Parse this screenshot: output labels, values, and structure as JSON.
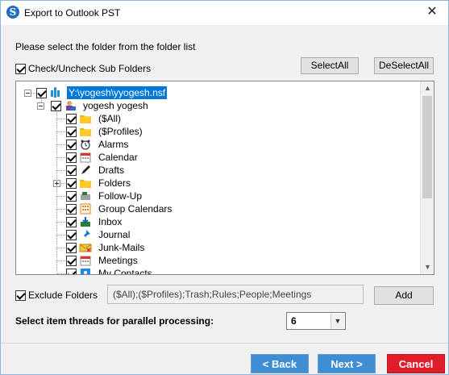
{
  "window": {
    "title": "Export to Outlook PST",
    "app_icon_letter": "S",
    "close_glyph": "✕"
  },
  "instruction": "Please select the folder from the folder list",
  "subfolders_label": "Check/Uncheck Sub Folders",
  "buttons": {
    "select_all": "SelectAll",
    "deselect_all": "DeSelectAll",
    "add": "Add",
    "back": "< Back",
    "next": "Next >",
    "cancel": "Cancel"
  },
  "tree": {
    "root": {
      "label": "Y:\\yogesh\\yyogesh.nsf",
      "icon": "database-icon",
      "checked": true,
      "selected": true
    },
    "user": {
      "label": "yogesh yogesh",
      "icon": "user-mailbox-icon",
      "checked": true
    },
    "items": [
      {
        "label": "($All)",
        "icon": "folder-icon",
        "checked": true
      },
      {
        "label": "($Profiles)",
        "icon": "folder-icon",
        "checked": true
      },
      {
        "label": "Alarms",
        "icon": "alarm-clock-icon",
        "checked": true
      },
      {
        "label": "Calendar",
        "icon": "calendar-icon",
        "checked": true
      },
      {
        "label": "Drafts",
        "icon": "pen-icon",
        "checked": true
      },
      {
        "label": "Folders",
        "icon": "folder-icon",
        "checked": true,
        "expandable": true
      },
      {
        "label": "Follow-Up",
        "icon": "follow-up-icon",
        "checked": true
      },
      {
        "label": "Group Calendars",
        "icon": "group-calendar-icon",
        "checked": true
      },
      {
        "label": "Inbox",
        "icon": "inbox-icon",
        "checked": true
      },
      {
        "label": "Journal",
        "icon": "pin-icon",
        "checked": true
      },
      {
        "label": "Junk-Mails",
        "icon": "junk-mail-icon",
        "checked": true
      },
      {
        "label": "Meetings",
        "icon": "calendar-icon",
        "checked": true
      },
      {
        "label": "My Contacts",
        "icon": "contacts-icon",
        "checked": true
      }
    ]
  },
  "exclude": {
    "label": "Exclude Folders",
    "checked": true,
    "value": "($All);($Profiles);Trash;Rules;People;Meetings"
  },
  "threads": {
    "label": "Select item threads for parallel processing:",
    "value": "6"
  },
  "colors": {
    "accent_blue": "#3f8ed4",
    "cancel_red": "#e01e2a",
    "selection_blue": "#0078d7"
  }
}
